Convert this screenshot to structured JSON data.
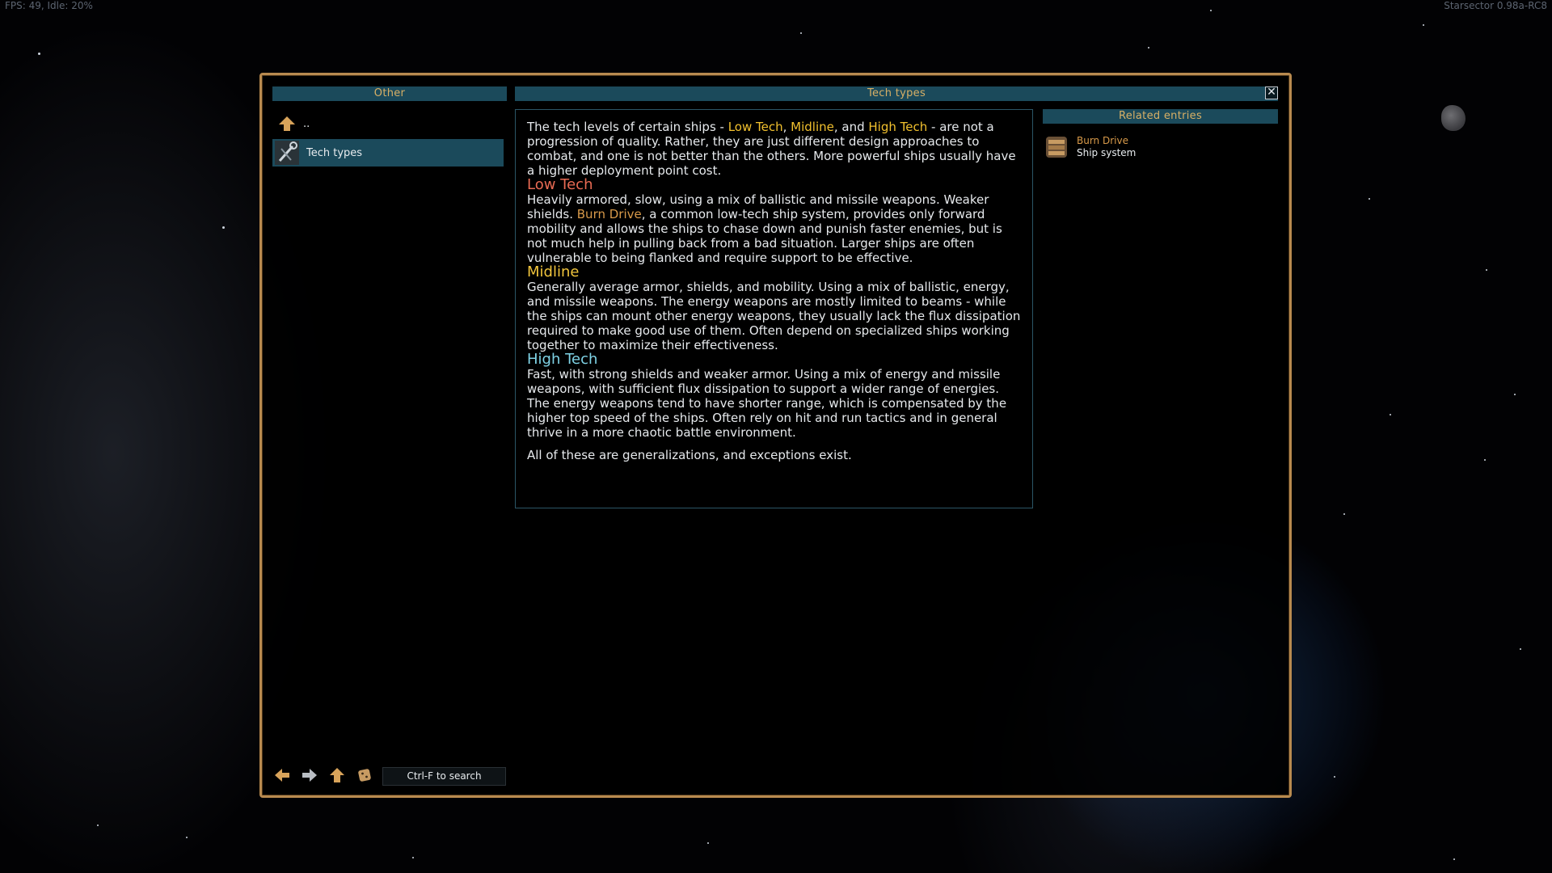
{
  "hud": {
    "fps": "FPS: 49, Idle: 20%",
    "version": "Starsector 0.98a-RC8"
  },
  "codex": {
    "left_header": "Other",
    "main_header": "Tech types",
    "related_header": "Related entries",
    "close_icon": "close-icon",
    "list": {
      "parent_label": "..",
      "items": [
        {
          "label": "Tech types",
          "icon": "tool-icon",
          "selected": true
        }
      ]
    },
    "article": {
      "intro_1": "The tech levels of certain ships - ",
      "low_tech_link": "Low Tech",
      "sep_1": ", ",
      "midline_link": "Midline",
      "sep_2": ", and ",
      "high_tech_link": "High Tech",
      "intro_2": " - are not a progression of quality. Rather, they are just different design approaches to combat, and one is not better than the others. More powerful ships usually have a higher deployment point cost.",
      "low_tech_heading": "Low Tech",
      "low_tech_1": "Heavily armored, slow, using a mix of ballistic and missile weapons. Weaker shields. ",
      "burn_drive_link": "Burn Drive",
      "low_tech_2": ", a common low-tech ship system, provides only forward mobility and allows the ships to chase down and punish faster enemies, but is not much help in pulling back from a bad situation. Larger ships are often vulnerable to being flanked and require support to be effective.",
      "midline_heading": "Midline",
      "midline_text": "Generally average armor, shields, and mobility. Using a mix of ballistic, energy, and missile weapons. The energy weapons are mostly limited to beams - while the ships can mount other energy weapons, they usually lack the flux dissipation required to make good use of them. Often depend on specialized ships working together to maximize their effectiveness.",
      "high_tech_heading": "High Tech",
      "high_tech_text": "Fast, with strong shields and weaker armor. Using a mix of energy and missile weapons, with sufficient flux dissipation to support a wider range of energies. The energy weapons tend to have shorter range, which is compensated by the higher top speed of the ships. Often rely on hit and run tactics and in general thrive in a more chaotic battle environment.",
      "closing": "All of these are generalizations, and exceptions exist."
    },
    "related": [
      {
        "name": "Burn Drive",
        "type": "Ship system",
        "icon": "burn-drive-icon"
      }
    ],
    "bottom": {
      "search_placeholder": "Ctrl-F to search",
      "icons": [
        "back-arrow-icon",
        "forward-arrow-icon",
        "up-arrow-icon",
        "random-entry-icon"
      ]
    },
    "colors": {
      "frame": "#b88a4f",
      "header_bar": "#1b4a5b",
      "header_text": "#d8b066",
      "low_tech": "#e86a53",
      "midline": "#f0c43c",
      "high_tech": "#7fd3e6",
      "link_yellow": "#f2c12e",
      "link_orange": "#d89a4a"
    }
  }
}
